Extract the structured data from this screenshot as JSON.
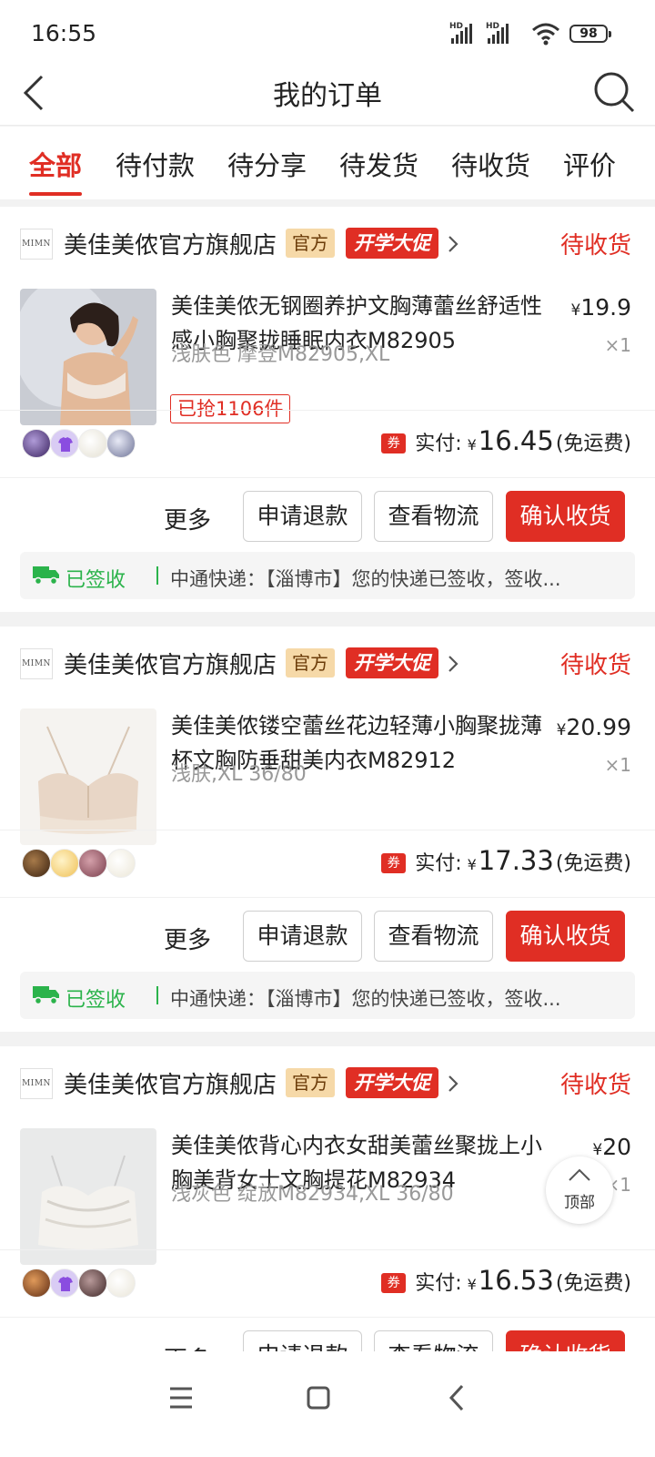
{
  "status_bar": {
    "time": "16:55",
    "signal1": "HD",
    "signal2": "HD",
    "battery": "98"
  },
  "header": {
    "title": "我的订单",
    "back_icon": "chevron-left-icon",
    "search_icon": "search-icon"
  },
  "tabs": [
    {
      "label": "全部",
      "active": true
    },
    {
      "label": "待付款"
    },
    {
      "label": "待分享"
    },
    {
      "label": "待发货"
    },
    {
      "label": "待收货"
    },
    {
      "label": "评价"
    }
  ],
  "orders": [
    {
      "shop_logo": "MIMN",
      "shop_name": "美佳美侬官方旗舰店",
      "badge_official": "官方",
      "badge_promo": "开学大促",
      "status": "待收货",
      "title": "美佳美侬无钢圈养护文胸薄蕾丝舒适性感小胸聚拢睡眠内衣M82905",
      "spec": "浅肤色 摩登M82905,XL",
      "sold": "已抢1106件",
      "price_symbol": "¥",
      "price": "19.9",
      "qty": "×1",
      "coupon": "券",
      "paid_label": "实付:",
      "paid_symbol": "¥",
      "paid_amount": "16.45",
      "shipping": "(免运费)",
      "swatch_colors": [
        "#5b3f8a",
        "#c9b6f0",
        "#efece4",
        "#9aa0c0"
      ],
      "more": "更多",
      "btn_refund": "申请退款",
      "btn_logistics": "查看物流",
      "btn_confirm": "确认收货",
      "log_status": "已签收",
      "log_msg": "中通快递：【淄博市】您的快递已签收，签收..."
    },
    {
      "shop_logo": "MIMN",
      "shop_name": "美佳美侬官方旗舰店",
      "badge_official": "官方",
      "badge_promo": "开学大促",
      "status": "待收货",
      "title": "美佳美侬镂空蕾丝花边轻薄小胸聚拢薄杯文胸防垂甜美内衣M82912",
      "spec": "浅肤,XL 36/80",
      "price_symbol": "¥",
      "price": "20.99",
      "qty": "×1",
      "coupon": "券",
      "paid_label": "实付:",
      "paid_symbol": "¥",
      "paid_amount": "17.33",
      "shipping": "(免运费)",
      "swatch_colors": [
        "#5a3a1c",
        "#f2d080",
        "#a9606e",
        "#f3efe2"
      ],
      "more": "更多",
      "btn_refund": "申请退款",
      "btn_logistics": "查看物流",
      "btn_confirm": "确认收货",
      "log_status": "已签收",
      "log_msg": "中通快递：【淄博市】您的快递已签收，签收..."
    },
    {
      "shop_logo": "MIMN",
      "shop_name": "美佳美侬官方旗舰店",
      "badge_official": "官方",
      "badge_promo": "开学大促",
      "status": "待收货",
      "title": "美佳美侬背心内衣女甜美蕾丝聚拢上小胸美背女士文胸提花M82934",
      "spec": "浅灰色 绽放M82934,XL 36/80",
      "price_symbol": "¥",
      "price": "20",
      "qty": "×1",
      "coupon": "券",
      "paid_label": "实付:",
      "paid_symbol": "¥",
      "paid_amount": "16.53",
      "shipping": "(免运费)",
      "swatch_colors": [
        "#8a4e24",
        "#c9b6f0",
        "#6e5050",
        "#f1eee4"
      ],
      "more": "更多",
      "btn_refund": "申请退款",
      "btn_logistics": "查看物流",
      "btn_confirm": "确认收货"
    }
  ],
  "back_to_top": "顶部",
  "nav": {
    "menu_icon": "menu-icon",
    "home_icon": "home-icon",
    "back_icon": "back-icon"
  }
}
